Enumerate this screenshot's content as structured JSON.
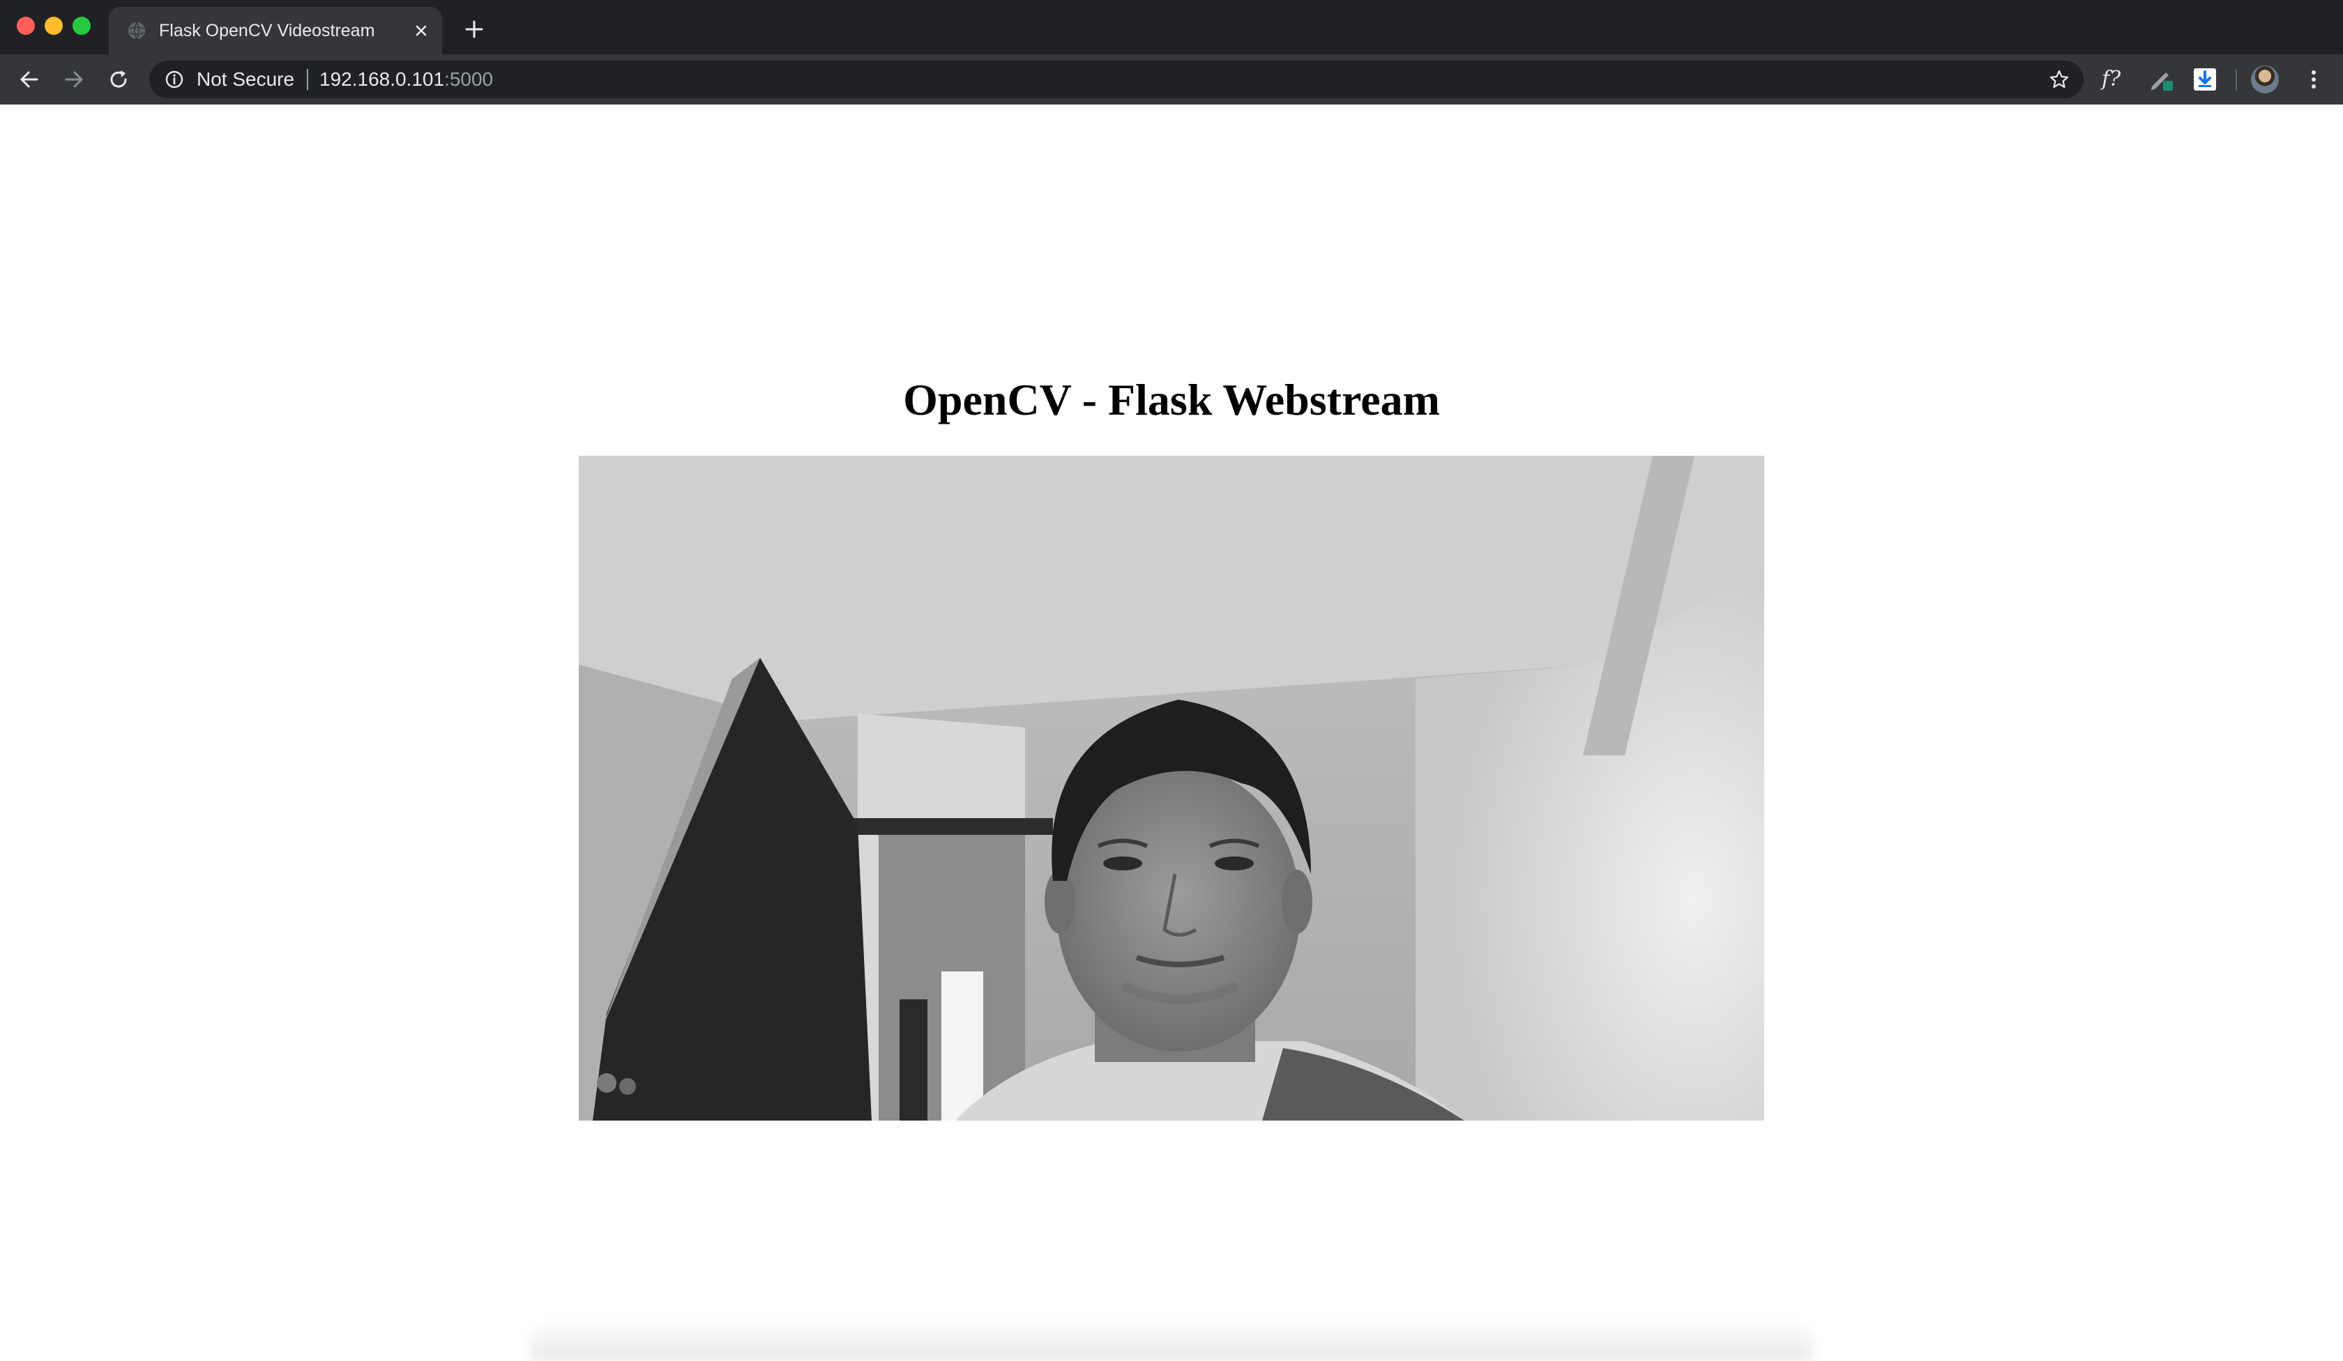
{
  "browser": {
    "tab": {
      "title": "Flask OpenCV Videostream"
    },
    "toolbar": {
      "security_label": "Not Secure",
      "url_host": "192.168.0.101",
      "url_port": ":5000",
      "extensions": {
        "formula_label": "f?"
      }
    },
    "icons": {
      "tab_favicon": "globe-icon",
      "tab_close": "close-icon",
      "new_tab": "plus-icon",
      "back": "arrow-left-icon",
      "forward": "arrow-right-icon",
      "reload": "reload-icon",
      "info": "info-icon",
      "bookmark": "star-icon",
      "extension_pen": "pen-icon",
      "extension_download": "download-icon",
      "profile": "avatar",
      "menu": "kebab-menu-icon"
    },
    "colors": {
      "frame": "#202124",
      "toolbar": "#35363a",
      "text": "#e8eaed",
      "muted": "#9aa0a6"
    }
  },
  "page": {
    "heading": "OpenCV - Flask Webstream",
    "video_frame": {
      "description": "grayscale webcam stream"
    },
    "background": "#ffffff"
  }
}
